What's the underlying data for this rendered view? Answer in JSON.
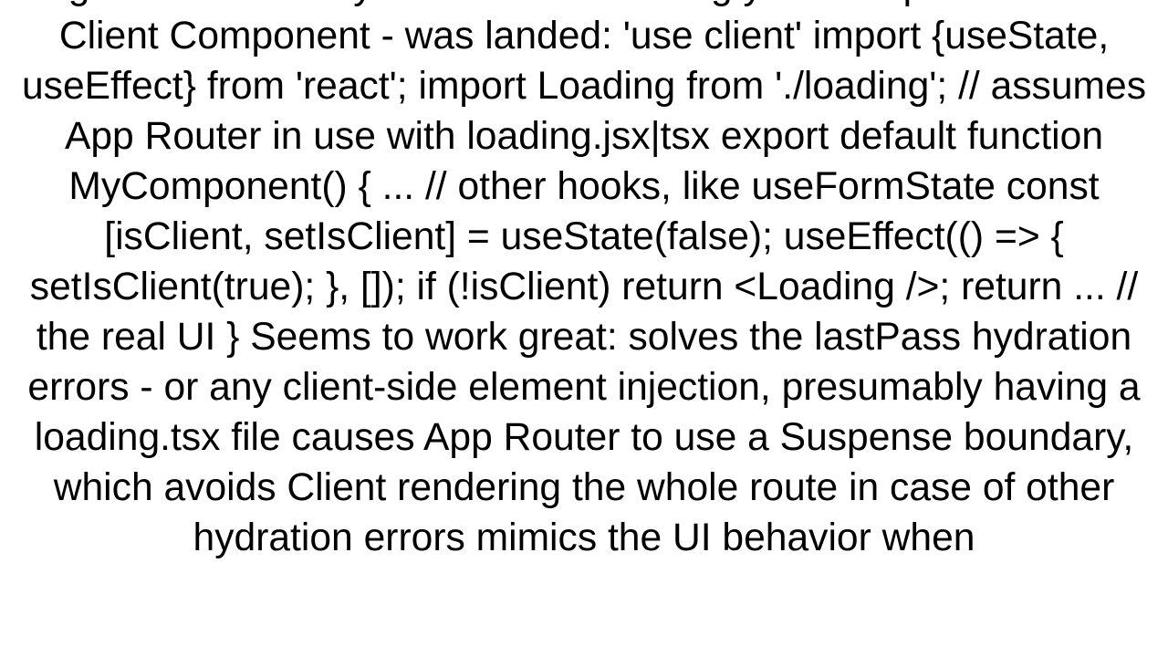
{
  "body_text": "elegant solution - if you don't mind forcing your component to be a Client Component - was landed: 'use client'  import {useState, useEffect} from 'react'; import Loading from './loading'; // assumes App Router in use with loading.jsx|tsx  export default function MyComponent() {   ... // other hooks, like useFormState    const [isClient, setIsClient] = useState(false);   useEffect(() => {     setIsClient(true);   }, []);      if (!isClient) return <Loading />;    return ... // the real UI }  Seems to work great:  solves the lastPass hydration errors - or any client-side element injection, presumably having a loading.tsx file causes App Router to use a Suspense boundary, which avoids Client rendering the whole route in case of other hydration errors mimics the UI behavior when"
}
